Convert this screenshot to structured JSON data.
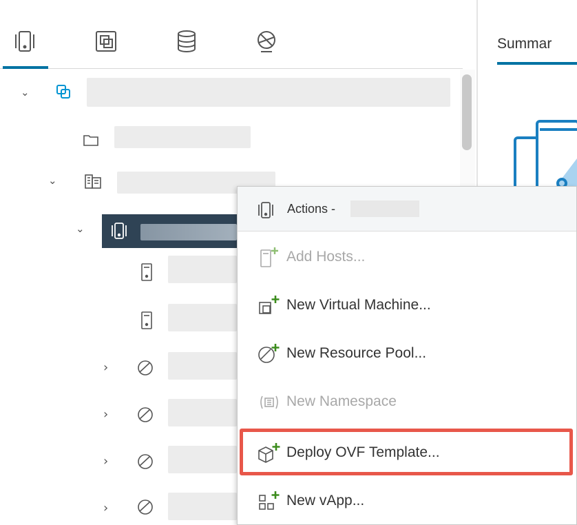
{
  "nav_tabs": [
    {
      "name": "hosts-and-clusters",
      "icon": "hosts-clusters-icon"
    },
    {
      "name": "vms-and-templates",
      "icon": "vms-templates-icon"
    },
    {
      "name": "storage",
      "icon": "database-icon"
    },
    {
      "name": "networking",
      "icon": "network-icon"
    }
  ],
  "right_pane": {
    "tab_label": "Summar"
  },
  "context_menu": {
    "header": "Actions -",
    "items": [
      {
        "label": "Add Hosts...",
        "icon": "add-host-icon",
        "disabled": true
      },
      {
        "label": "New Virtual Machine...",
        "icon": "new-vm-icon",
        "disabled": false
      },
      {
        "label": "New Resource Pool...",
        "icon": "new-resource-pool-icon",
        "disabled": false
      },
      {
        "label": "New Namespace",
        "icon": "namespace-icon",
        "disabled": true
      },
      {
        "label": "Deploy OVF Template...",
        "icon": "deploy-ovf-icon",
        "disabled": false,
        "highlighted": true
      },
      {
        "label": "New vApp...",
        "icon": "new-vapp-icon",
        "disabled": false
      }
    ]
  },
  "colors": {
    "accent": "#0072a3",
    "selected_row": "#2f4355",
    "highlight_border": "#e8574a",
    "add_badge": "#3c8c1d",
    "vcenter_icon": "#0094d2"
  }
}
